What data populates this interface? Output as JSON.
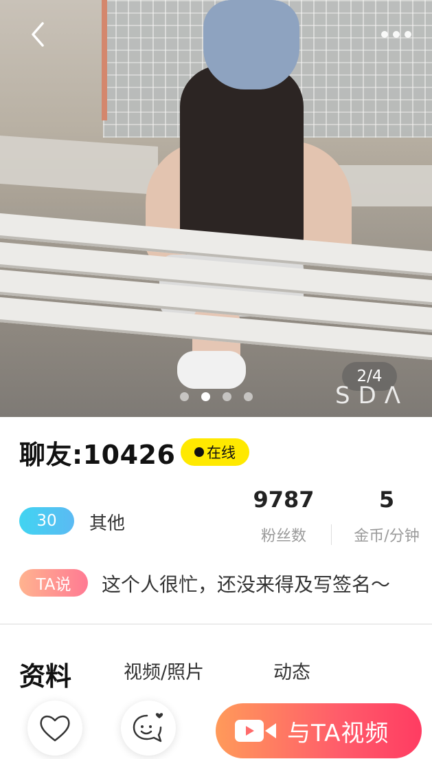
{
  "gallery": {
    "counter": "2/4",
    "watermark": "SDΛ",
    "total_photos": 4,
    "active_index": 2
  },
  "profile": {
    "name": "聊友:10426",
    "status": "在线",
    "age": "30",
    "gender": "其他",
    "ta_label": "TA说",
    "signature": "这个人很忙，还没来得及写签名～"
  },
  "stats": {
    "fans_value": "9787",
    "fans_label": "粉丝数",
    "rate_value": "5",
    "rate_label": "金币/分钟"
  },
  "tabs": [
    {
      "label": "资料",
      "active": true
    },
    {
      "label": "视频/照片",
      "active": false
    },
    {
      "label": "动态",
      "active": false
    }
  ],
  "actions": {
    "video_call_label": "与TA视频"
  },
  "icons": {
    "back": "back-chevron-icon",
    "more": "more-dots-icon",
    "like": "heart-icon",
    "chat": "smile-chat-icon",
    "video": "video-camera-icon"
  },
  "colors": {
    "online_badge": "#ffe900",
    "age_badge": "#41d4f1",
    "ta_badge": "#ff7a93",
    "video_button": "#ff5c6a"
  }
}
